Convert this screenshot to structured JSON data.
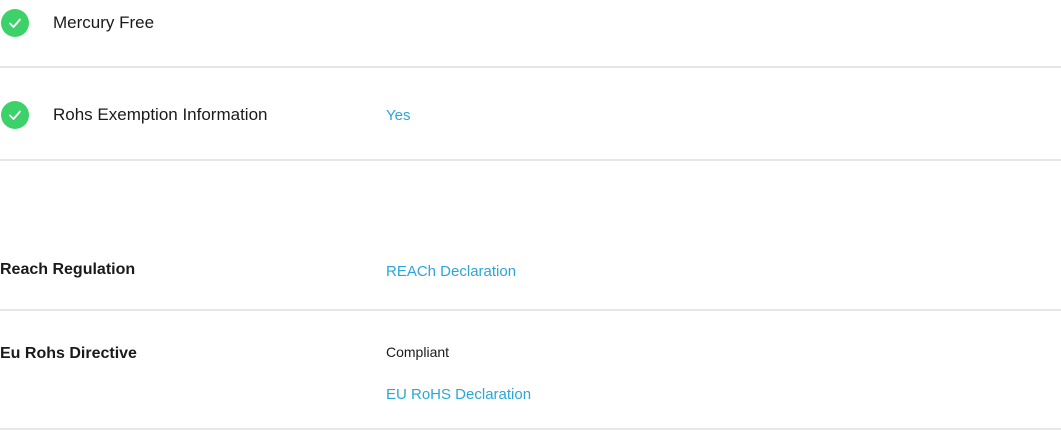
{
  "environmental": {
    "mercury_free": {
      "label": "Mercury Free",
      "icon": "check-circle-icon"
    },
    "rohs_exemption": {
      "label": "Rohs Exemption Information",
      "value": "Yes",
      "icon": "check-circle-icon"
    }
  },
  "regulations": {
    "reach": {
      "title": "Reach Regulation",
      "link": "REACh Declaration"
    },
    "eu_rohs": {
      "title": "Eu Rohs Directive",
      "status": "Compliant",
      "link": "EU RoHS Declaration"
    }
  },
  "colors": {
    "check_green": "#3dd16a",
    "link_blue": "#2aa7d8",
    "divider": "#e6e6e6"
  }
}
